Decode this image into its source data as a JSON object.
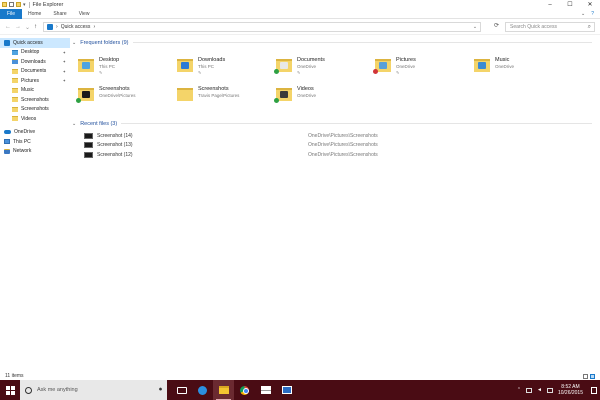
{
  "window": {
    "title": "File Explorer",
    "controls": {
      "minimize": "–",
      "maximize": "☐",
      "close": "✕"
    }
  },
  "ribbon": {
    "tabs": [
      {
        "label": "File",
        "active": true
      },
      {
        "label": "Home"
      },
      {
        "label": "Share"
      },
      {
        "label": "View"
      }
    ],
    "expand_icon": "chevron-down-icon",
    "help_icon": "help-icon"
  },
  "address": {
    "back": "←",
    "forward": "→",
    "recent": "⌄",
    "up": "↑",
    "path": "Quick access",
    "separator": "›",
    "refresh": "⟳",
    "dropdown": "⌄"
  },
  "search": {
    "placeholder": "Search Quick access",
    "icon": "⌕"
  },
  "sidebar": {
    "items": [
      {
        "label": "Quick access",
        "icon": "star-icon",
        "top": true,
        "selected": true
      },
      {
        "label": "Desktop",
        "icon": "folder-desktop-icon",
        "pinned": true
      },
      {
        "label": "Downloads",
        "icon": "folder-downloads-icon",
        "pinned": true
      },
      {
        "label": "Documents",
        "icon": "folder-documents-icon",
        "pinned": true
      },
      {
        "label": "Pictures",
        "icon": "folder-pictures-icon",
        "pinned": true
      },
      {
        "label": "Music",
        "icon": "folder-music-icon"
      },
      {
        "label": "Screenshots",
        "icon": "folder-icon"
      },
      {
        "label": "Screenshots",
        "icon": "folder-icon"
      },
      {
        "label": "Videos",
        "icon": "folder-videos-icon"
      },
      {
        "label": "OneDrive",
        "icon": "onedrive-icon",
        "top": true
      },
      {
        "label": "This PC",
        "icon": "this-pc-icon",
        "top": true
      },
      {
        "label": "Network",
        "icon": "network-icon",
        "top": true
      }
    ],
    "pin_glyph": "📌"
  },
  "frequent": {
    "header": "Frequent folders (9)",
    "folders": [
      {
        "name": "Desktop",
        "location": "This PC",
        "pinned": true,
        "overlay": "#4fa3e0",
        "status": ""
      },
      {
        "name": "Downloads",
        "location": "This PC",
        "pinned": true,
        "overlay": "#2b7bd6",
        "status": ""
      },
      {
        "name": "Documents",
        "location": "OneDrive",
        "pinned": true,
        "overlay": "#e8e8e8",
        "status": "#2ea043"
      },
      {
        "name": "Pictures",
        "location": "OneDrive",
        "pinned": true,
        "overlay": "#5aa0d8",
        "status": "#d13438"
      },
      {
        "name": "Music",
        "location": "OneDrive",
        "pinned": false,
        "overlay": "#3b8ad4",
        "status": ""
      },
      {
        "name": "Screenshots",
        "location": "OneDrive\\Pictures",
        "pinned": false,
        "overlay": "#1a1a1a",
        "status": "#2ea043"
      },
      {
        "name": "Screenshots",
        "location": "Travis Page\\Pictures",
        "pinned": false,
        "overlay": "",
        "status": ""
      },
      {
        "name": "Videos",
        "location": "OneDrive",
        "pinned": false,
        "overlay": "#3a3a3a",
        "status": "#2ea043"
      }
    ],
    "pin_glyph": "✎"
  },
  "recent": {
    "header": "Recent files (3)",
    "files": [
      {
        "name": "Screenshot (14)",
        "path": "OneDrive\\Pictures\\Screenshots"
      },
      {
        "name": "Screenshot (13)",
        "path": "OneDrive\\Pictures\\Screenshots"
      },
      {
        "name": "Screenshot (12)",
        "path": "OneDrive\\Pictures\\Screenshots"
      }
    ]
  },
  "status": {
    "item_count": "11 items"
  },
  "taskbar": {
    "search_placeholder": "Ask me anything",
    "mic": "🎤",
    "apps": [
      {
        "name": "task-view",
        "active": false
      },
      {
        "name": "edge",
        "active": false
      },
      {
        "name": "file-explorer",
        "active": true
      },
      {
        "name": "chrome",
        "active": false
      },
      {
        "name": "mail",
        "active": false
      },
      {
        "name": "remote-desktop",
        "active": false
      }
    ],
    "tray": {
      "chevron": "⌃",
      "time": "8:52 AM",
      "date": "10/26/2015"
    }
  }
}
